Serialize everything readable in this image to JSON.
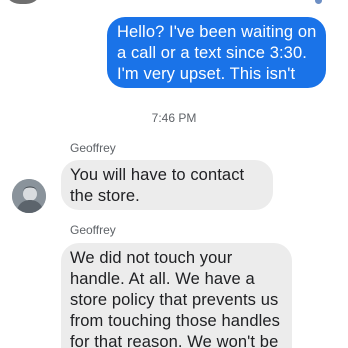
{
  "messages": {
    "outgoing_1": "Hello? I've been waiting on a call or a text since 3:30. I'm very upset. This isn't right.",
    "timestamp": "7:46 PM",
    "incoming_1": {
      "sender": "Geoffrey",
      "text": "You will have to contact the store."
    },
    "incoming_2": {
      "sender": "Geoffrey",
      "text": "We did not touch your handle. At all. We have a store policy that prevents us from touching those handles for that reason. We won't be responding to messages on"
    }
  },
  "icons": {
    "contact_avatar": "avatar-photo",
    "top_avatar": "avatar-photo"
  },
  "colors": {
    "outgoing_bubble": "#1a73e8",
    "incoming_bubble": "#ececec",
    "meta_text": "#5f6368"
  }
}
